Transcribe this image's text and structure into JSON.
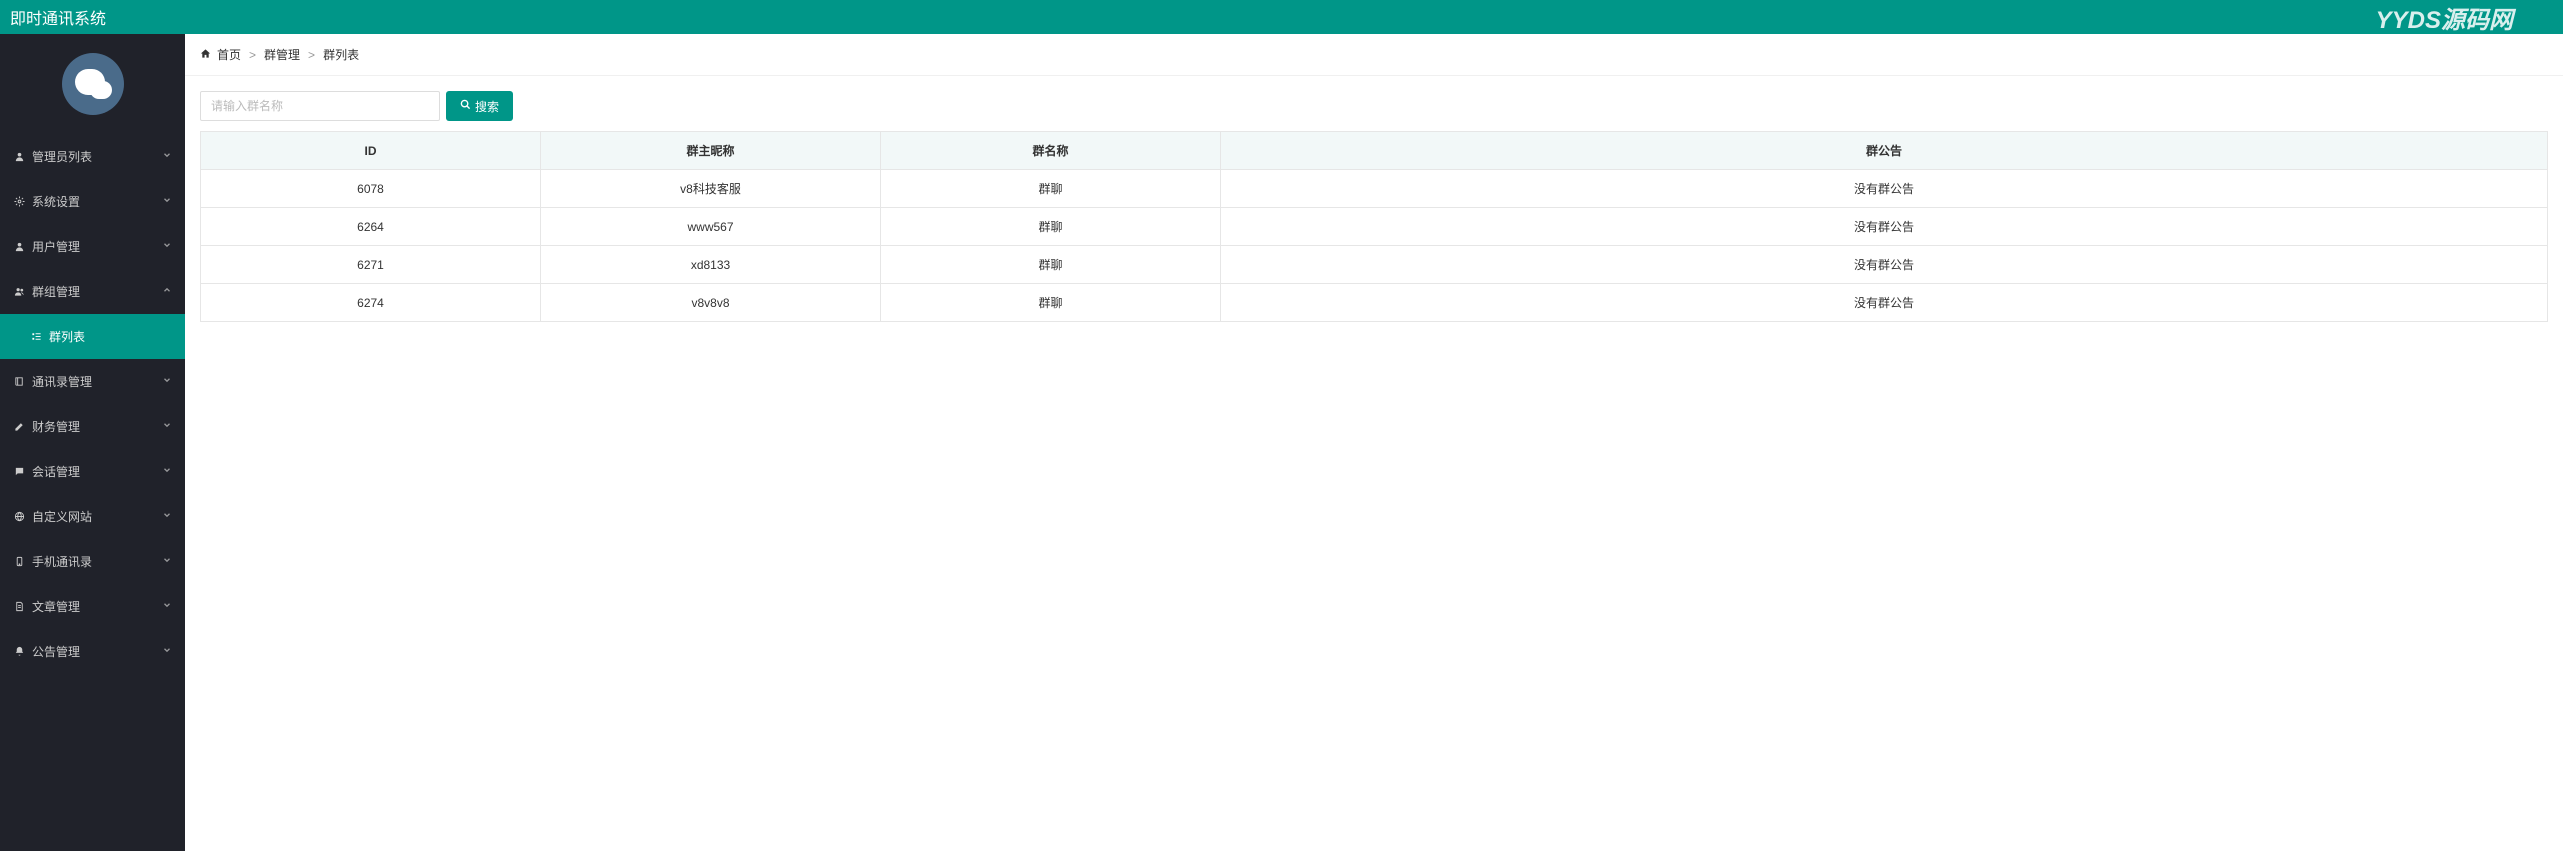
{
  "header": {
    "title": "即时通讯系统",
    "brand": "YYDS源码网"
  },
  "sidebar": {
    "items": [
      {
        "icon": "user",
        "label": "管理员列表",
        "chevron": "down"
      },
      {
        "icon": "cog",
        "label": "系统设置",
        "chevron": "down"
      },
      {
        "icon": "user",
        "label": "用户管理",
        "chevron": "down"
      },
      {
        "icon": "users",
        "label": "群组管理",
        "chevron": "up"
      },
      {
        "icon": "list",
        "label": "群列表",
        "chevron": "",
        "active": true
      },
      {
        "icon": "book",
        "label": "通讯录管理",
        "chevron": "down"
      },
      {
        "icon": "edit",
        "label": "财务管理",
        "chevron": "down"
      },
      {
        "icon": "chat",
        "label": "会话管理",
        "chevron": "down"
      },
      {
        "icon": "globe",
        "label": "自定义网站",
        "chevron": "down"
      },
      {
        "icon": "phone",
        "label": "手机通讯录",
        "chevron": "down"
      },
      {
        "icon": "doc",
        "label": "文章管理",
        "chevron": "down"
      },
      {
        "icon": "bell",
        "label": "公告管理",
        "chevron": "down"
      }
    ]
  },
  "breadcrumb": {
    "home": "首页",
    "parent": "群管理",
    "current": "群列表"
  },
  "search": {
    "placeholder": "请输入群名称",
    "buttonLabel": "搜索"
  },
  "table": {
    "headers": {
      "id": "ID",
      "owner": "群主昵称",
      "name": "群名称",
      "notice": "群公告"
    },
    "rows": [
      {
        "id": "6078",
        "owner": "v8科技客服",
        "name": "群聊",
        "notice": "没有群公告"
      },
      {
        "id": "6264",
        "owner": "www567",
        "name": "群聊",
        "notice": "没有群公告"
      },
      {
        "id": "6271",
        "owner": "xd8133",
        "name": "群聊",
        "notice": "没有群公告"
      },
      {
        "id": "6274",
        "owner": "v8v8v8",
        "name": "群聊",
        "notice": "没有群公告"
      }
    ]
  }
}
